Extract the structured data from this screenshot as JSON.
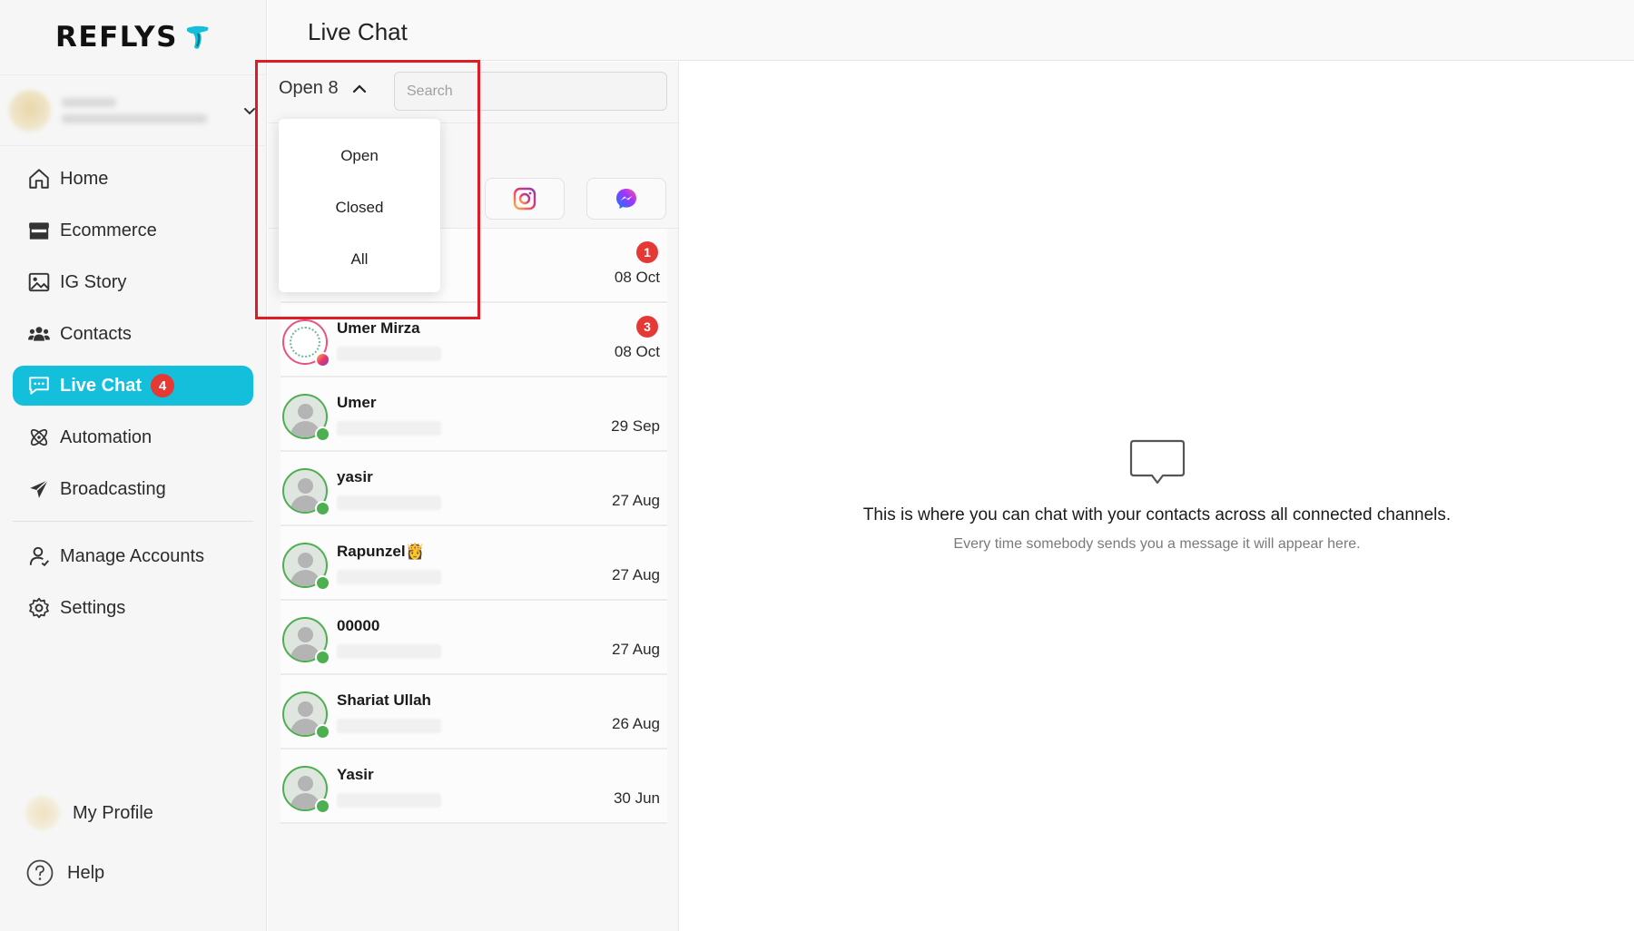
{
  "brand": {
    "name": "REFLYS",
    "accent": "#14bfdc"
  },
  "header": {
    "title": "Live Chat"
  },
  "sidebar": {
    "items": [
      {
        "label": "Home",
        "icon": "home-icon"
      },
      {
        "label": "Ecommerce",
        "icon": "store-icon"
      },
      {
        "label": "IG Story",
        "icon": "image-icon"
      },
      {
        "label": "Contacts",
        "icon": "users-icon"
      },
      {
        "label": "Live Chat",
        "icon": "chat-icon",
        "badge": "4",
        "active": true
      },
      {
        "label": "Automation",
        "icon": "automation-icon"
      },
      {
        "label": "Broadcasting",
        "icon": "send-icon"
      },
      {
        "label": "Manage Accounts",
        "icon": "user-icon"
      },
      {
        "label": "Settings",
        "icon": "gear-icon"
      }
    ],
    "bottom": {
      "profile_label": "My Profile",
      "help_label": "Help"
    }
  },
  "chat_list": {
    "status_label": "Open 8",
    "search_placeholder": "Search",
    "channels": [
      "instagram-icon",
      "messenger-icon"
    ],
    "conversations": [
      {
        "name": "",
        "date": "08 Oct",
        "unread": "1",
        "channel": "whatsapp"
      },
      {
        "name": "Umer Mirza",
        "date": "08 Oct",
        "unread": "3",
        "channel": "instagram"
      },
      {
        "name": "Umer",
        "date": "29 Sep",
        "channel": "whatsapp"
      },
      {
        "name": "yasir",
        "date": "27 Aug",
        "channel": "whatsapp"
      },
      {
        "name": "Rapunzel👸",
        "date": "27 Aug",
        "channel": "whatsapp"
      },
      {
        "name": "00000",
        "date": "27 Aug",
        "channel": "whatsapp"
      },
      {
        "name": "Shariat Ullah",
        "date": "26 Aug",
        "channel": "whatsapp"
      },
      {
        "name": "Yasir",
        "date": "30 Jun",
        "channel": "whatsapp"
      }
    ]
  },
  "status_dropdown": {
    "options": [
      "Open",
      "Closed",
      "All"
    ]
  },
  "empty_state": {
    "title": "This is where you can chat with your contacts across all connected channels.",
    "subtitle": "Every time somebody sends you a message it will appear here."
  },
  "colors": {
    "badge": "#e53935",
    "whatsapp": "#4caf50",
    "highlight": "#e01b24"
  }
}
